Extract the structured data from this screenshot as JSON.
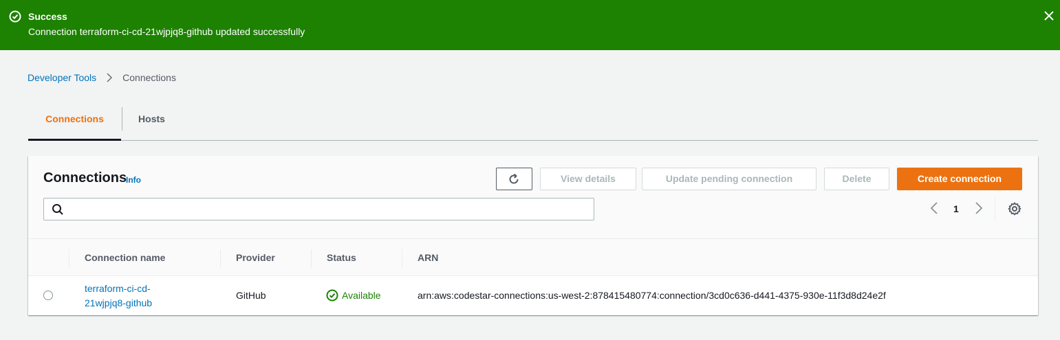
{
  "flash": {
    "title": "Success",
    "message": "Connection terraform-ci-cd-21wjpjq8-github updated successfully",
    "close_icon": "close-icon",
    "status_icon": "success-icon"
  },
  "breadcrumb": {
    "parent": "Developer Tools",
    "current": "Connections"
  },
  "tabs": [
    {
      "label": "Connections",
      "active": true
    },
    {
      "label": "Hosts",
      "active": false
    }
  ],
  "panel": {
    "title": "Connections",
    "info": "Info",
    "buttons": {
      "view_details": "View details",
      "update_pending": "Update pending connection",
      "delete": "Delete",
      "create": "Create connection"
    },
    "search": {
      "value": "",
      "placeholder": ""
    },
    "pagination": {
      "current_page": "1"
    }
  },
  "table": {
    "columns": [
      "Connection name",
      "Provider",
      "Status",
      "ARN"
    ],
    "rows": [
      {
        "name": "terraform-ci-cd-21wjpjq8-github",
        "provider": "GitHub",
        "status": "Available",
        "arn": "arn:aws:codestar-connections:us-west-2:878415480774:connection/3cd0c636-d441-4375-930e-11f3d8d24e2f"
      }
    ]
  },
  "colors": {
    "success_green": "#1d8102",
    "link_blue": "#0073bb",
    "accent_orange": "#ec7211"
  }
}
